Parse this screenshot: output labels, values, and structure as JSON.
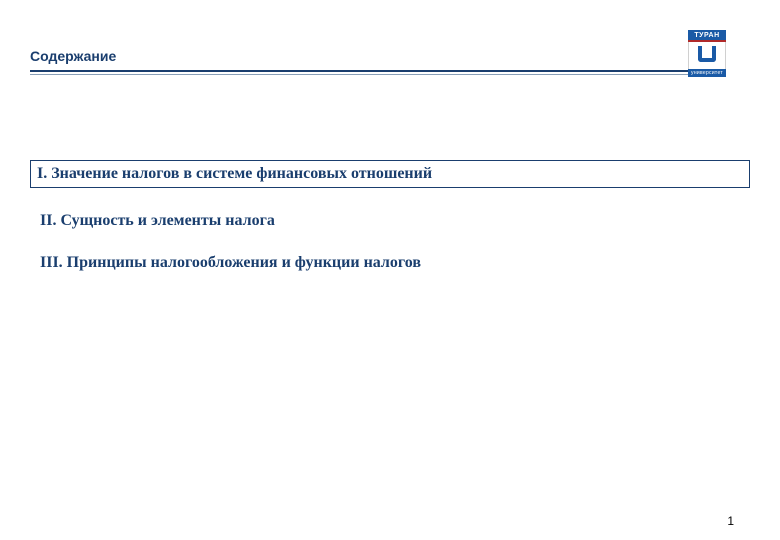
{
  "header": {
    "title": "Содержание"
  },
  "logo": {
    "top_label": "ТУРАН",
    "bottom_label": "университет"
  },
  "toc": {
    "item1": "I. Значение налогов в системе финансовых отношений",
    "item2": "II. Сущность и элементы налога",
    "item3": "III. Принципы налогообложения и функции налогов"
  },
  "page_number": "1"
}
